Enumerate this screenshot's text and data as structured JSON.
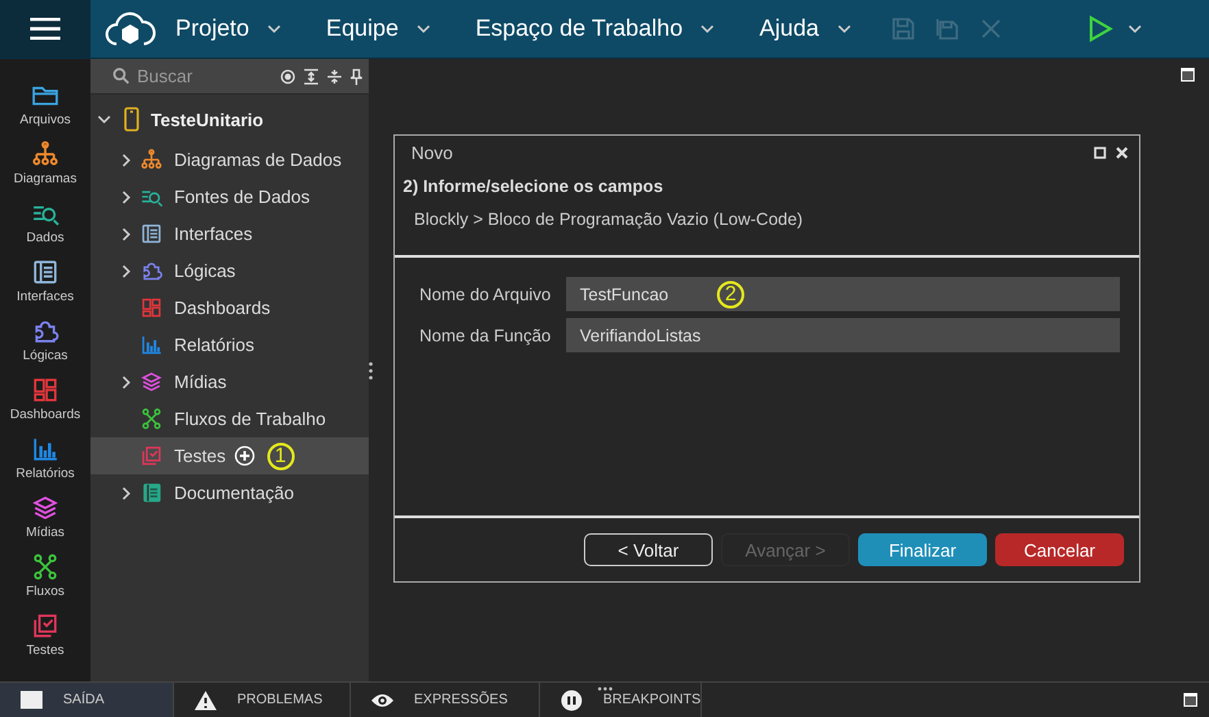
{
  "menus": [
    {
      "label": "Projeto"
    },
    {
      "label": "Equipe"
    },
    {
      "label": "Espaço de Trabalho"
    },
    {
      "label": "Ajuda"
    }
  ],
  "toolbar": [
    {
      "kind": "save",
      "disabled": true
    },
    {
      "kind": "save-all",
      "disabled": true
    },
    {
      "kind": "close",
      "disabled": true
    }
  ],
  "rail": [
    {
      "kind": "files",
      "label": "Arquivos"
    },
    {
      "kind": "diagrams",
      "label": "Diagramas"
    },
    {
      "kind": "data",
      "label": "Dados"
    },
    {
      "kind": "interfaces",
      "label": "Interfaces"
    },
    {
      "kind": "logic",
      "label": "Lógicas"
    },
    {
      "kind": "dashboards",
      "label": "Dashboards"
    },
    {
      "kind": "reports",
      "label": "Relatórios"
    },
    {
      "kind": "media",
      "label": "Mídias"
    },
    {
      "kind": "flows",
      "label": "Fluxos"
    },
    {
      "kind": "tests",
      "label": "Testes"
    }
  ],
  "search": {
    "placeholder": "Buscar"
  },
  "tree": {
    "label": "TesteUnitario",
    "expanded": true,
    "children": [
      {
        "kind": "diagrams",
        "label": "Diagramas de Dados",
        "expandable": true,
        "selected": false
      },
      {
        "kind": "data",
        "label": "Fontes de Dados",
        "expandable": true,
        "selected": false
      },
      {
        "kind": "interfaces",
        "label": "Interfaces",
        "expandable": true,
        "selected": false
      },
      {
        "kind": "logic",
        "label": "Lógicas",
        "expandable": true,
        "selected": false
      },
      {
        "kind": "dashboards",
        "label": "Dashboards",
        "expandable": false,
        "selected": false
      },
      {
        "kind": "reports",
        "label": "Relatórios",
        "expandable": false,
        "selected": false
      },
      {
        "kind": "media",
        "label": "Mídias",
        "expandable": true,
        "selected": false
      },
      {
        "kind": "flows",
        "label": "Fluxos de Trabalho",
        "expandable": false,
        "selected": false
      },
      {
        "kind": "tests",
        "label": "Testes",
        "expandable": false,
        "selected": true,
        "callout": "1"
      },
      {
        "kind": "docs",
        "label": "Documentação",
        "expandable": true,
        "selected": false
      }
    ]
  },
  "dialog": {
    "title": "Novo",
    "step": "2) Informe/selecione os campos",
    "path": "Blockly > Bloco de Programação Vazio (Low-Code)",
    "fields": [
      {
        "label": "Nome do Arquivo",
        "value": "TestFuncao",
        "callout": "2"
      },
      {
        "label": "Nome da Função",
        "value": "VerifiandoListas"
      }
    ],
    "buttons": [
      {
        "kind": "outline",
        "label": "< Voltar",
        "disabled": false
      },
      {
        "kind": "plain",
        "label": "Avançar >",
        "disabled": true
      },
      {
        "kind": "primary",
        "label": "Finalizar",
        "disabled": false
      },
      {
        "kind": "danger",
        "label": "Cancelar",
        "disabled": false
      }
    ]
  },
  "bottom_tabs": [
    {
      "kind": "output",
      "label": "SAÍDA",
      "selected": true
    },
    {
      "kind": "problems",
      "label": "PROBLEMAS",
      "selected": false
    },
    {
      "kind": "expressions",
      "label": "EXPRESSÕES",
      "selected": false
    },
    {
      "kind": "breakpoints",
      "label": "BREAKPOINTS",
      "selected": false
    }
  ]
}
